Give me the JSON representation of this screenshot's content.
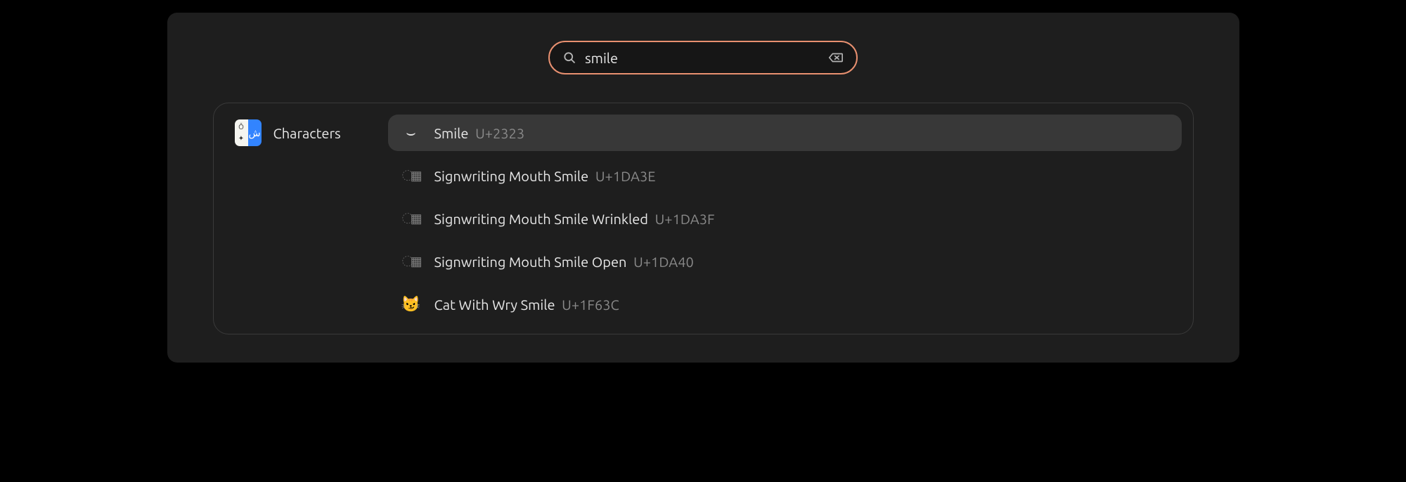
{
  "search": {
    "value": "smile",
    "placeholder": ""
  },
  "category": {
    "label": "Characters"
  },
  "results": [
    {
      "glyph": "⌣",
      "name": "Smile",
      "code": "U+2323",
      "selected": true,
      "missing": false
    },
    {
      "glyph": "",
      "name": "Signwriting Mouth Smile",
      "code": "U+1DA3E",
      "selected": false,
      "missing": true
    },
    {
      "glyph": "",
      "name": "Signwriting Mouth Smile Wrinkled",
      "code": "U+1DA3F",
      "selected": false,
      "missing": true
    },
    {
      "glyph": "",
      "name": "Signwriting Mouth Smile Open",
      "code": "U+1DA40",
      "selected": false,
      "missing": true
    },
    {
      "glyph": "😼",
      "name": "Cat With Wry Smile",
      "code": "U+1F63C",
      "selected": false,
      "missing": false
    }
  ]
}
